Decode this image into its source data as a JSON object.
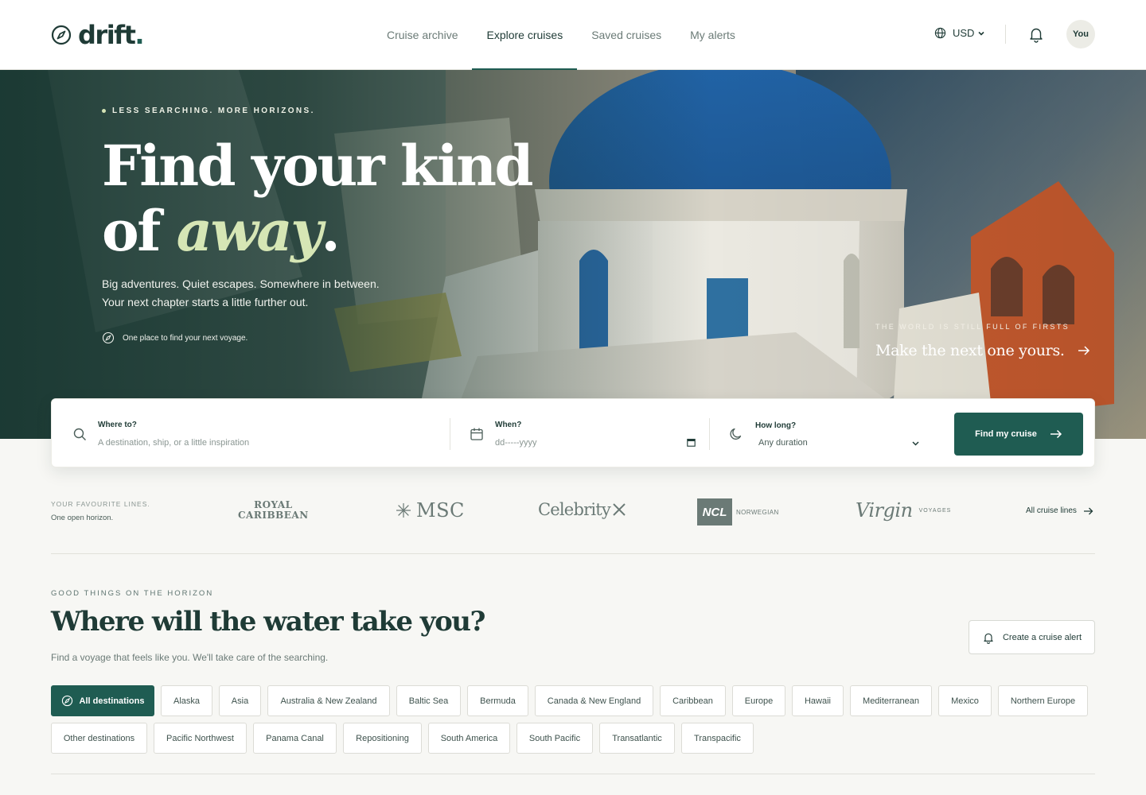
{
  "brand": {
    "name": "drift",
    "dot": "."
  },
  "nav": [
    {
      "label": "Cruise archive",
      "active": false
    },
    {
      "label": "Explore cruises",
      "active": true
    },
    {
      "label": "Saved cruises",
      "active": false
    },
    {
      "label": "My alerts",
      "active": false
    }
  ],
  "header": {
    "currency": "USD",
    "avatar": "You"
  },
  "hero": {
    "eyebrow": "LESS SEARCHING. MORE HORIZONS.",
    "title_line1": "Find your kind",
    "title_of": "of ",
    "title_em": "away",
    "title_end": ".",
    "subtitle_line1": "Big adventures. Quiet escapes. Somewhere in between.",
    "subtitle_line2": "Your next chapter starts a little further out.",
    "tagline": "One place to find your next voyage.",
    "kicker": "THE WORLD IS STILL FULL OF FIRSTS",
    "promo": "Make the next one yours."
  },
  "search": {
    "where_label": "Where to?",
    "where_placeholder": "A destination, ship, or a little inspiration",
    "when_label": "When?",
    "when_placeholder": "dd-----yyyy",
    "duration_label": "How long?",
    "duration_value": "Any duration",
    "submit": "Find my cruise"
  },
  "lines": {
    "label": "YOUR FAVOURITE LINES.",
    "sub": "One open horizon.",
    "royal_1": "ROYAL",
    "royal_2": "CARIBBEAN",
    "msc": "MSC",
    "celebrity": "Celebrity",
    "ncl": "NCL",
    "ncl_sub": "NORWEGIAN",
    "virgin": "Virgin",
    "virgin_sub": "VOYAGES",
    "all": "All cruise lines"
  },
  "section": {
    "eyebrow": "GOOD THINGS ON THE HORIZON",
    "title": "Where will the water take you?",
    "subtitle": "Find a voyage that feels like you. We'll take care of the searching.",
    "alert_button": "Create a cruise alert"
  },
  "destinations": [
    "All destinations",
    "Alaska",
    "Asia",
    "Australia & New Zealand",
    "Baltic Sea",
    "Bermuda",
    "Canada & New England",
    "Caribbean",
    "Europe",
    "Hawaii",
    "Mediterranean",
    "Mexico",
    "Northern Europe",
    "Other destinations",
    "Pacific Northwest",
    "Panama Canal",
    "Repositioning",
    "South America",
    "South Pacific",
    "Transatlantic",
    "Transpacific"
  ],
  "colors": {
    "accent": "#1f5c52",
    "text": "#1f3b36",
    "highlight": "#d6e6b5"
  }
}
